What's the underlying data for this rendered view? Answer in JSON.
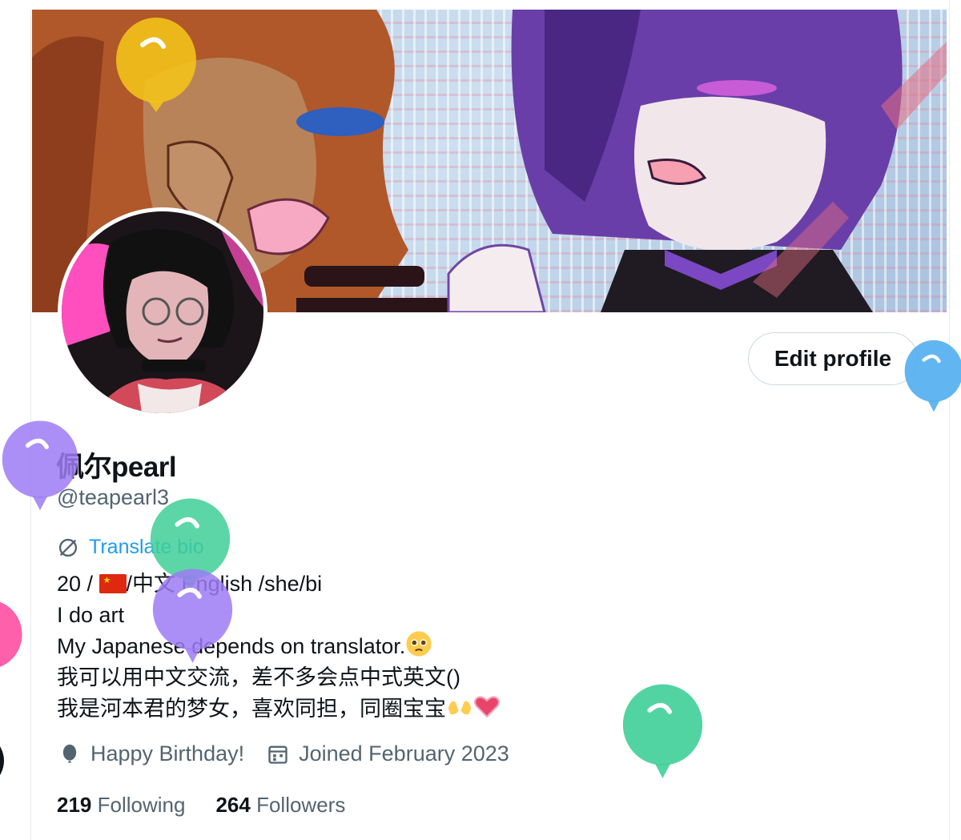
{
  "profile": {
    "display_name": "佩尔pearl",
    "handle": "@teapearl3",
    "edit_profile_label": "Edit profile",
    "translate_bio_label": "Translate bio",
    "bio": {
      "line1_prefix": "20 / ",
      "line1_suffix": "/中文 English /she/bi",
      "line2": "I do art",
      "line3": "My Japanese depends on translator.",
      "line4": "我可以用中文交流，差不多会点中式英文()",
      "line5": "我是河本君的梦女，喜欢同担，同圈宝宝"
    },
    "location": "Happy Birthday!",
    "joined": "Joined February 2023",
    "following_count": "219",
    "following_label": "Following",
    "followers_count": "264",
    "followers_label": "Followers"
  },
  "icons": {
    "translate": "globe-slash-icon",
    "location": "balloon-icon",
    "calendar": "calendar-icon",
    "flag": "china-flag-icon",
    "pleading": "pleading-face-emoji",
    "hands": "palms-up-emoji",
    "heart": "heart-emoji"
  },
  "colors": {
    "accent": "#1d9bf0",
    "muted": "#536471",
    "text": "#0f1419",
    "balloon_yellow": "#f2c418",
    "balloon_blue": "#50aef0",
    "balloon_purple": "#9d7bf5",
    "balloon_green": "#3fcf98",
    "balloon_pink": "#ff4fa0"
  }
}
